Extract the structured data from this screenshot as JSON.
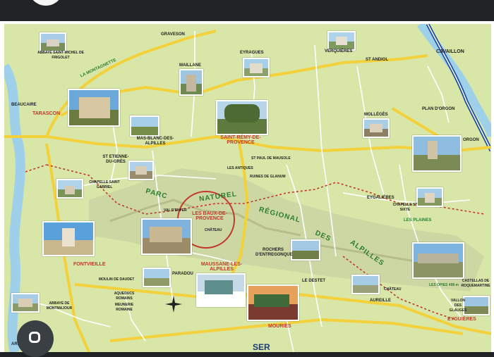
{
  "map": {
    "places": {
      "graveson": "GRAVESON",
      "eyragues": "EYRAGUES",
      "verquieres": "VERQUIÈRES",
      "saint_andiol": "ST ANDIOL",
      "cavaillon": "CAVAILLON",
      "abbaye_frigolet": "ABBAYE SAINT MICHEL DE FRIGOLET",
      "la_montagnette": "LA MONTAGNETTE",
      "maillane": "MAILLANE",
      "beaucaire": "BEAUCAIRE",
      "tarascon": "TARASCON",
      "plan_orgon": "PLAN D'ORGON",
      "mollegès": "MOLLÉGÈS",
      "orgon": "ORGON",
      "mas_blanc": "MAS-BLANC-DES-ALPILLES",
      "saint_remy": "SAINT-RÉMY-DE-PROVENCE",
      "st_etienne": "ST ETIENNE-DU-GRÈS",
      "les_antiques": "LES ANTIQUES",
      "st_paul": "ST PAUL DE MAUSOLE",
      "ruines_glanum": "RUINES DE GLANUM",
      "chapelle_st_gabriel": "CHAPELLE SAINT GABRIEL",
      "eygalieres": "EYGALIÈRES",
      "chapelle_st_sixte": "CHAPELLE ST SIXTE",
      "les_plaines": "LES PLAINES",
      "val_denfer": "VAL D'ENFER",
      "les_baux": "LES BAUX-DE-PROVENCE",
      "chateau": "CHÂTEAU",
      "fontvieille": "FONTVIEILLE",
      "rochers": "ROCHERS D'ENTREGONQUE",
      "moulin_daudet": "MOULIN DE DAUDET",
      "paradou": "PARADOU",
      "maussane": "MAUSSANE-LES-ALPILLES",
      "le_destet": "LE DESTET",
      "aureille": "AUREILLE",
      "chateau2": "CHÂTEAU",
      "les_opies": "LES OPIES 498 m",
      "castellas": "CASTELLAS DE ROQUEMARTINE",
      "vallon_glauges": "VALLON DES GLAUGES",
      "eyguieres": "EYGUIÈRES",
      "aqueducs": "AQUEDUCS ROMAINS",
      "meunerie": "MEUNERIE ROMAINE",
      "abbaye_montmajour": "ABBAYE DE MONTMAJOUR",
      "mouries": "MOURIÈS",
      "arles": "ARLES"
    },
    "park": {
      "w1": "PARC",
      "w2": "NATUREL",
      "w3": "RÉGIONAL",
      "w4": "DES",
      "w5": "ALPILLES"
    },
    "brand": "SER"
  },
  "colors": {
    "land": "#d8e6a8",
    "road_major": "#f2d13a",
    "road_minor": "#ffffff",
    "water": "#9fd0ea",
    "motorway": "#1e4e9c",
    "trail": "#c0392b",
    "mountain": "#c9cfa0"
  }
}
